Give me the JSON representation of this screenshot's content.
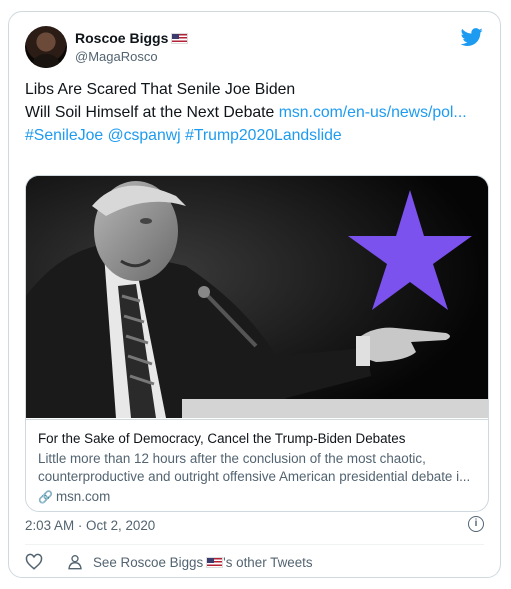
{
  "author": {
    "name": "Roscoe Biggs",
    "handle": "@MagaRosco"
  },
  "tweet": {
    "line1": "Libs Are Scared That Senile Joe Biden",
    "line2": "Will Soil Himself at the Next Debate ",
    "link": "msn.com/en-us/news/pol...",
    "hashtags": [
      "#SenileJoe",
      "@cspanwj",
      "#Trump2020Landslide"
    ]
  },
  "card": {
    "title": "For the Sake of Democracy, Cancel the Trump-Biden Debates",
    "desc_line1": "Little more than 12 hours after the conclusion of the most chaotic,",
    "desc_line2": "counterproductive and outright offensive American presidential debate i...",
    "domain": "msn.com",
    "star_color": "#7b52ee"
  },
  "timestamp": "2:03 AM · Oct 2, 2020",
  "actions": {
    "see_prefix": "See Roscoe Biggs",
    "see_suffix": "'s other Tweets"
  },
  "colors": {
    "link_blue": "#1d9bf0",
    "twitter_blue": "#1d9bf0",
    "muted": "#536471"
  },
  "icons": [
    "twitter-bird-icon",
    "flag-us-icon",
    "link-icon",
    "info-icon",
    "heart-icon",
    "person-icon"
  ]
}
